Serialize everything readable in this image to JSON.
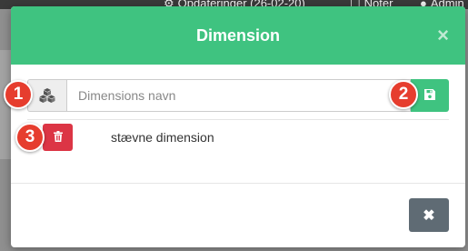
{
  "background": {
    "updates_label": "Opdateringer (26-02-20)",
    "notes_label": "Noter",
    "admin_label": "Admin"
  },
  "modal": {
    "title": "Dimension",
    "close_glyph": "×",
    "input": {
      "placeholder": "Dimensions navn",
      "value": ""
    },
    "items": [
      {
        "label": "stævne dimension"
      }
    ],
    "footer_close_glyph": "✖"
  },
  "markers": [
    "1",
    "2",
    "3"
  ],
  "colors": {
    "header": "#3fc380",
    "save": "#3fc380",
    "delete": "#dc3545",
    "close_button": "#5f6b74",
    "marker": "#e63d2e"
  },
  "icons": {
    "addon": "cubes-icon",
    "save": "save-icon",
    "delete": "trash-icon",
    "close": "close-icon"
  }
}
